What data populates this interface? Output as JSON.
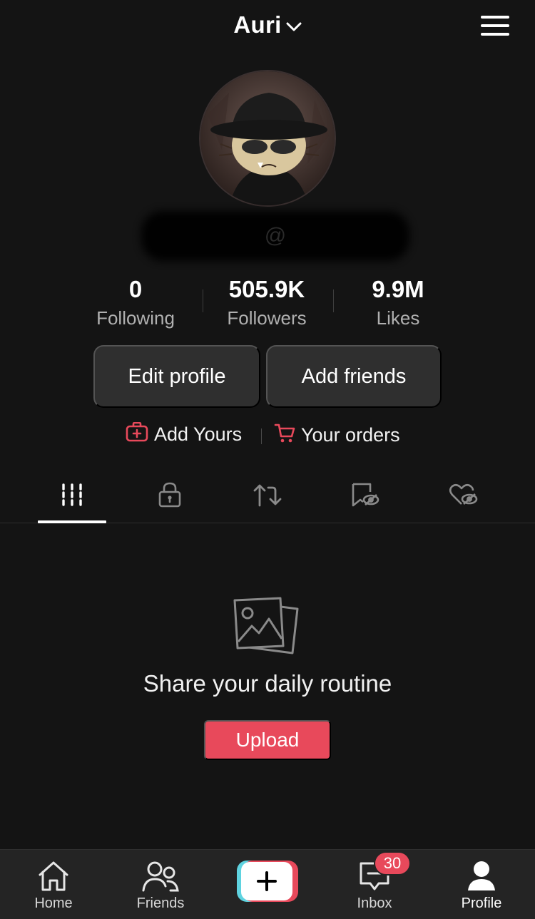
{
  "header": {
    "username": "Auri",
    "dropdown_icon": "chevron-down-icon",
    "menu_icon": "hamburger-menu-icon"
  },
  "profile": {
    "avatar_icon": "avatar-image",
    "handle": "@"
  },
  "stats": [
    {
      "value": "0",
      "label": "Following"
    },
    {
      "value": "505.9K",
      "label": "Followers"
    },
    {
      "value": "9.9M",
      "label": "Likes"
    }
  ],
  "actions": {
    "edit_profile": "Edit profile",
    "add_friends": "Add friends"
  },
  "links": {
    "add_yours": "Add Yours",
    "your_orders": "Your orders",
    "accent": "#e8495b"
  },
  "tabs": [
    {
      "icon": "grid-videos-icon",
      "active": true
    },
    {
      "icon": "lock-private-icon",
      "active": false
    },
    {
      "icon": "repost-icon",
      "active": false
    },
    {
      "icon": "hidden-favorites-icon",
      "active": false
    },
    {
      "icon": "hidden-liked-icon",
      "active": false
    }
  ],
  "empty_state": {
    "icon": "photos-icon",
    "title": "Share your daily routine",
    "button": "Upload"
  },
  "navbar": {
    "items": [
      {
        "label": "Home",
        "icon": "home-icon"
      },
      {
        "label": "Friends",
        "icon": "friends-icon"
      },
      {
        "label": "",
        "icon": "create-plus-icon"
      },
      {
        "label": "Inbox",
        "icon": "inbox-icon"
      },
      {
        "label": "Profile",
        "icon": "profile-icon"
      }
    ],
    "inbox_badge": "30",
    "active": "Profile"
  }
}
